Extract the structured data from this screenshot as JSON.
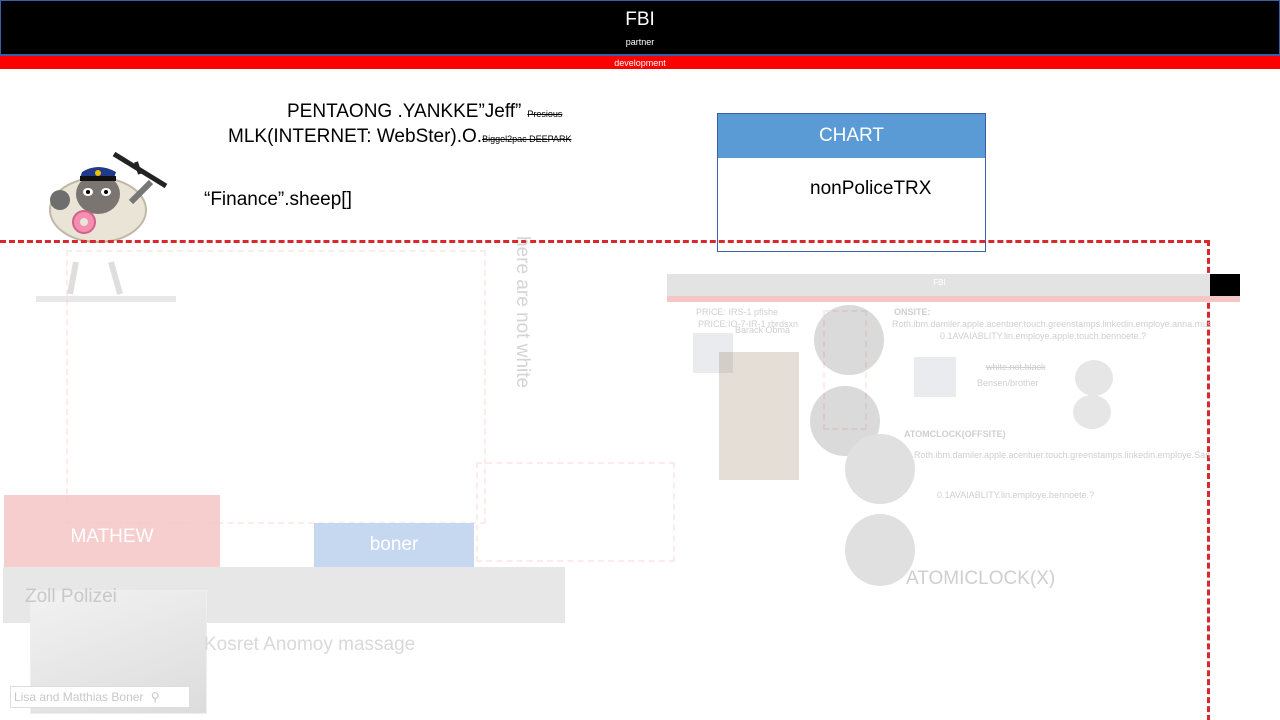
{
  "header": {
    "title": "FBI",
    "subtitle": "partner",
    "bar_label": "development"
  },
  "headline": {
    "line1": "PENTAONG .YANKKE”Jeff”",
    "line1_strike": "Presious",
    "line2": "MLK(INTERNET: WebSter).O.",
    "line2_small": "Biggel2pac DEEPARK",
    "line3": "“Finance”.sheep[]"
  },
  "chart_box": {
    "header": "CHART",
    "body": "nonPoliceTRX"
  },
  "faded": {
    "vertical_text": "here are not white",
    "mathew": "MATHEW",
    "boner": "boner",
    "zoll": "Zoll Polizei",
    "caption": "Lisa and Matthias Boner",
    "kosret": "Kosret Anomoy massage",
    "mini_header": "FBI",
    "price1": "PRICE: IRS-1 pfishe",
    "price2": "PRICE:IO-7-IR-1 rbrdsxn",
    "barack": "Barack Obma",
    "onsite": "ONSITE:",
    "roth1": "Roth.ibm.damiler.apple.acentuer.touch.greenstamps.linkedin.employe.anna.mus",
    "avail1": "0.1AVAIABLITY.lin.employe.apple.touch.bennoete.?",
    "white": "white.not.black",
    "bensen": "Bensen/brother",
    "atom_offsite": "ATOMCLOCK(OFFSITE)",
    "roth2": "Roth.ibm.damiler.apple.acentuer.touch.greenstamps.linkedin.employe.San",
    "avail2": "0.1AVAIABLITY.lin.employe.bennoete.?",
    "atomic": "ATOMICLOCK(X)"
  },
  "colors": {
    "header_bg": "#000000",
    "dev_bar": "#ff0000",
    "chart_header": "#5b9bd5",
    "dashed_frame": "#d9272e"
  }
}
